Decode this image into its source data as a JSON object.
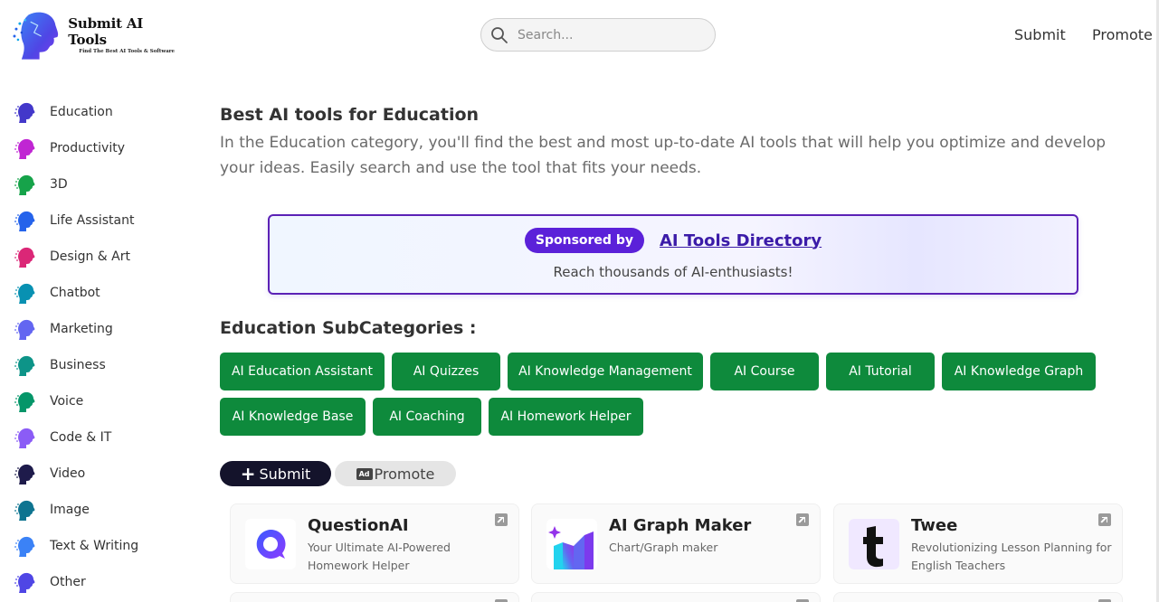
{
  "header": {
    "logo_title": "Submit AI Tools",
    "logo_subtitle": "Find The Best AI Tools & Software",
    "search_placeholder": "Search...",
    "nav": {
      "submit": "Submit",
      "promote": "Promote"
    }
  },
  "sidebar": {
    "items": [
      {
        "label": "Education",
        "color": "#4338ca"
      },
      {
        "label": "Productivity",
        "color": "#c026d3"
      },
      {
        "label": "3D",
        "color": "#16a34a"
      },
      {
        "label": "Life Assistant",
        "color": "#2563eb"
      },
      {
        "label": "Design & Art",
        "color": "#db2777"
      },
      {
        "label": "Chatbot",
        "color": "#0891b2"
      },
      {
        "label": "Marketing",
        "color": "#6366f1"
      },
      {
        "label": "Business",
        "color": "#0d9488"
      },
      {
        "label": "Voice",
        "color": "#059669"
      },
      {
        "label": "Code & IT",
        "color": "#8b5cf6"
      },
      {
        "label": "Video",
        "color": "#1e1b4b"
      },
      {
        "label": "Image",
        "color": "#0e7490"
      },
      {
        "label": "Text & Writing",
        "color": "#3b82f6"
      },
      {
        "label": "Other",
        "color": "#4f46e5"
      }
    ]
  },
  "main": {
    "title": "Best AI tools for Education",
    "description": "In the Education category, you'll find the best and most up-to-date AI tools that will help you optimize and develop your ideas. Easily search and use the tool that fits your needs."
  },
  "sponsor": {
    "badge": "Sponsored by",
    "link": "AI Tools Directory",
    "tagline": "Reach thousands of AI-enthusiasts!"
  },
  "subcategories": {
    "title": "Education SubCategories :",
    "items": [
      "AI Education Assistant",
      "AI Quizzes",
      "AI Knowledge Management",
      "AI Course",
      "AI Tutorial",
      "AI Knowledge Graph",
      "AI Knowledge Base",
      "AI Coaching",
      "AI Homework Helper"
    ]
  },
  "actions": {
    "submit": "Submit",
    "promote": "Promote",
    "ad_badge": "Ad"
  },
  "cards": [
    {
      "name": "QuestionAI",
      "description": "Your Ultimate AI-Powered Homework Helper"
    },
    {
      "name": "AI Graph Maker",
      "description": "Chart/Graph maker"
    },
    {
      "name": "Twee",
      "description": "Revolutionizing Lesson Planning for English Teachers"
    }
  ],
  "colors": {
    "accent_green": "#0e8a3c",
    "sponsor_purple": "#5b21d9",
    "submit_dark": "#14132b"
  }
}
